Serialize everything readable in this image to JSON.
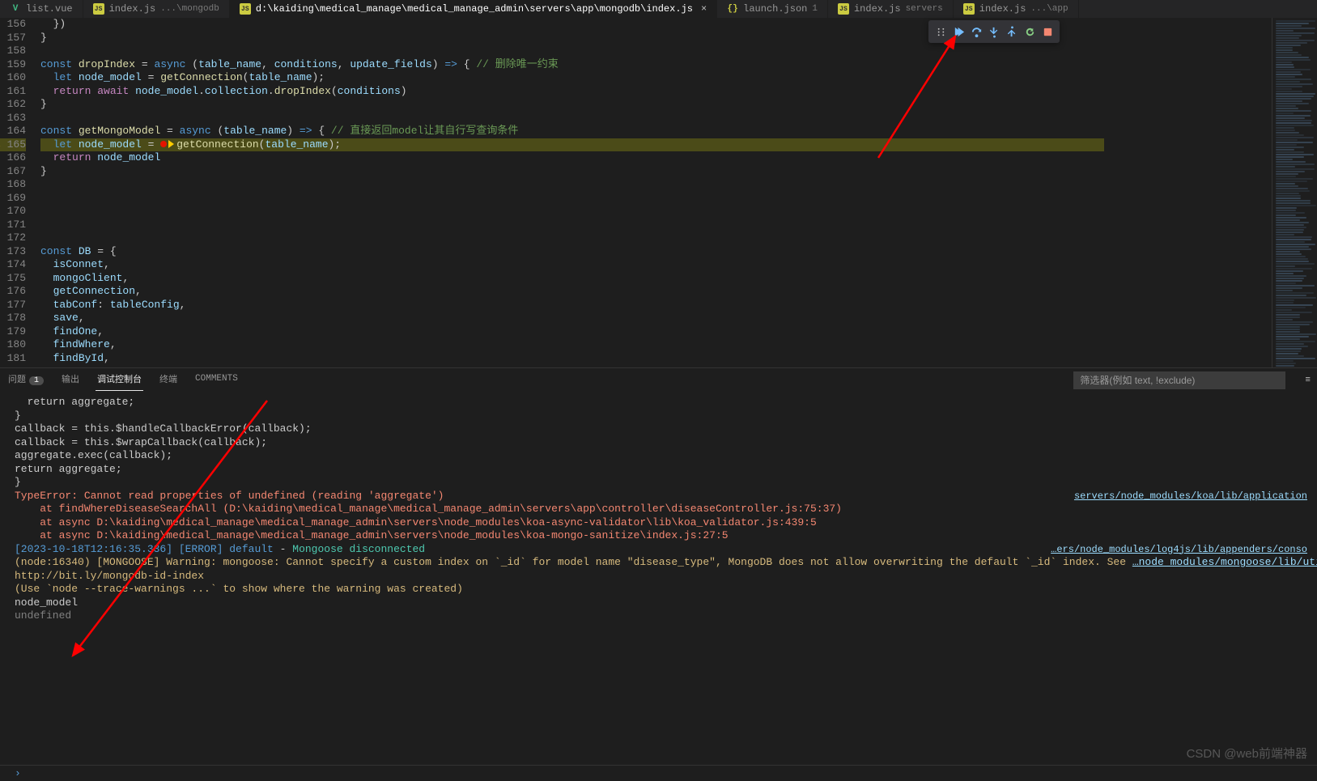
{
  "tabs": [
    {
      "icon": "vue",
      "iconText": "V",
      "label": "list.vue",
      "sub": "",
      "active": false
    },
    {
      "icon": "js",
      "iconText": "JS",
      "label": "index.js",
      "sub": "...\\mongodb",
      "active": false
    },
    {
      "icon": "js",
      "iconText": "JS",
      "label": "d:\\kaiding\\medical_manage\\medical_manage_admin\\servers\\app\\mongodb\\index.js",
      "sub": "",
      "active": true,
      "close": true
    },
    {
      "icon": "json",
      "iconText": "{}",
      "label": "launch.json",
      "sub": "1",
      "active": false
    },
    {
      "icon": "js",
      "iconText": "JS",
      "label": "index.js",
      "sub": "servers",
      "active": false
    },
    {
      "icon": "js",
      "iconText": "JS",
      "label": "index.js",
      "sub": "...\\app",
      "active": false
    }
  ],
  "gutter": [
    "156",
    "157",
    "158",
    "159",
    "160",
    "161",
    "162",
    "163",
    "164",
    "165",
    "166",
    "167",
    "168",
    "169",
    "170",
    "171",
    "172",
    "173",
    "174",
    "175",
    "176",
    "177",
    "178",
    "179",
    "180",
    "181"
  ],
  "code": [
    {
      "t": "  })"
    },
    {
      "t": "}"
    },
    {
      "t": ""
    },
    {
      "html": "<span class='k'>const</span> <span class='fn'>dropIndex</span> = <span class='k'>async</span> (<span class='id'>table_name</span>, <span class='id'>conditions</span>, <span class='id'>update_fields</span>) <span class='k'>=></span> { <span class='cm'>// 删除唯一约束</span>"
    },
    {
      "html": "  <span class='k'>let</span> <span class='id'>node_model</span> = <span class='fn'>getConnection</span>(<span class='id'>table_name</span>);"
    },
    {
      "html": "  <span class='kw'>return</span> <span class='kw'>await</span> <span class='id'>node_model</span>.<span class='id'>collection</span>.<span class='fn'>dropIndex</span>(<span class='id'>conditions</span>)"
    },
    {
      "t": "}"
    },
    {
      "t": ""
    },
    {
      "html": "<span class='k'>const</span> <span class='fn'>getMongoModel</span> = <span class='k'>async</span> (<span class='id'>table_name</span>) <span class='k'>=></span> { <span class='cm'>// 直接返回model让其自行写查询条件</span>"
    },
    {
      "html": "  <span class='k'>let</span> <span class='id'>node_model</span> = <span class='bp'></span><span class='stp'></span><span class='fn'>getConnection</span>(<span class='id'>table_name</span>);",
      "hl": true
    },
    {
      "html": "  <span class='kw'>return</span> <span class='id'>node_model</span>"
    },
    {
      "t": "}"
    },
    {
      "t": ""
    },
    {
      "t": ""
    },
    {
      "t": ""
    },
    {
      "t": ""
    },
    {
      "t": ""
    },
    {
      "html": "<span class='k'>const</span> <span class='id'>DB</span> = {"
    },
    {
      "html": "  <span class='id'>isConnet</span>,"
    },
    {
      "html": "  <span class='id'>mongoClient</span>,"
    },
    {
      "html": "  <span class='id'>getConnection</span>,"
    },
    {
      "html": "  <span class='id'>tabConf</span>: <span class='id'>tableConfig</span>,"
    },
    {
      "html": "  <span class='id'>save</span>,"
    },
    {
      "html": "  <span class='id'>findOne</span>,"
    },
    {
      "html": "  <span class='id'>findWhere</span>,"
    },
    {
      "html": "  <span class='id'>findById</span>,"
    }
  ],
  "panel": {
    "tabs": [
      {
        "label": "问题",
        "badge": "1"
      },
      {
        "label": "输出"
      },
      {
        "label": "调试控制台",
        "active": true
      },
      {
        "label": "终端"
      },
      {
        "label": "COMMENTS"
      }
    ],
    "filterPlaceholder": "筛选器(例如 text, !exclude)"
  },
  "consoleLines": [
    {
      "t": "  return aggregate;"
    },
    {
      "t": "}"
    },
    {
      "t": ""
    },
    {
      "t": "callback = this.$handleCallbackError(callback);"
    },
    {
      "t": "callback = this.$wrapCallback(callback);"
    },
    {
      "t": ""
    },
    {
      "t": "aggregate.exec(callback);"
    },
    {
      "t": "return aggregate;"
    },
    {
      "t": "}"
    },
    {
      "t": "",
      "rlink": "servers/node_modules/koa/lib/application"
    },
    {
      "html": "<span class='err'>TypeError: Cannot read properties of undefined (reading 'aggregate')</span>"
    },
    {
      "html": "<span class='stk'>    at findWhereDiseaseSearchAll (D:\\kaiding\\medical_manage\\medical_manage_admin\\servers\\app\\controller\\diseaseController.js:75:37)</span>"
    },
    {
      "html": "<span class='stk'>    at async D:\\kaiding\\medical_manage\\medical_manage_admin\\servers\\node_modules\\koa-async-validator\\lib\\koa_validator.js:439:5</span>"
    },
    {
      "html": "<span class='stk'>    at async D:\\kaiding\\medical_manage\\medical_manage_admin\\servers\\node_modules\\koa-mongo-sanitize\\index.js:27:5</span>"
    },
    {
      "t": ""
    },
    {
      "html": "<span class='info'>[2023-10-18T12:16:35.336] [ERROR] default</span> - <span class='cy'>Mongoose disconnected</span>",
      "rlink": "…ers/node_modules/log4js/lib/appenders/conso"
    },
    {
      "html": "<span class='warn'>(node:16340) [MONGOOSE] Warning: mongoose: Cannot specify a custom index on `_id` for model name \"disease_type\", MongoDB does not allow overwriting the default `_id` index. See </span><span class='link'>…node_modules/mongoose/lib/utils</span>"
    },
    {
      "html": "<span class='warn'>http://bit.ly/mongodb-id-index</span>"
    },
    {
      "html": "<span class='warn'>(Use `node --trace-warnings ...` to show where the warning was created)</span>"
    },
    {
      "t": "node_model"
    },
    {
      "html": "<span style='color:#808080'>undefined</span>"
    }
  ],
  "watermark": "CSDN @web前端神器",
  "debugBtns": [
    "drag",
    "continue",
    "step-over",
    "step-into",
    "step-out",
    "restart",
    "stop"
  ]
}
